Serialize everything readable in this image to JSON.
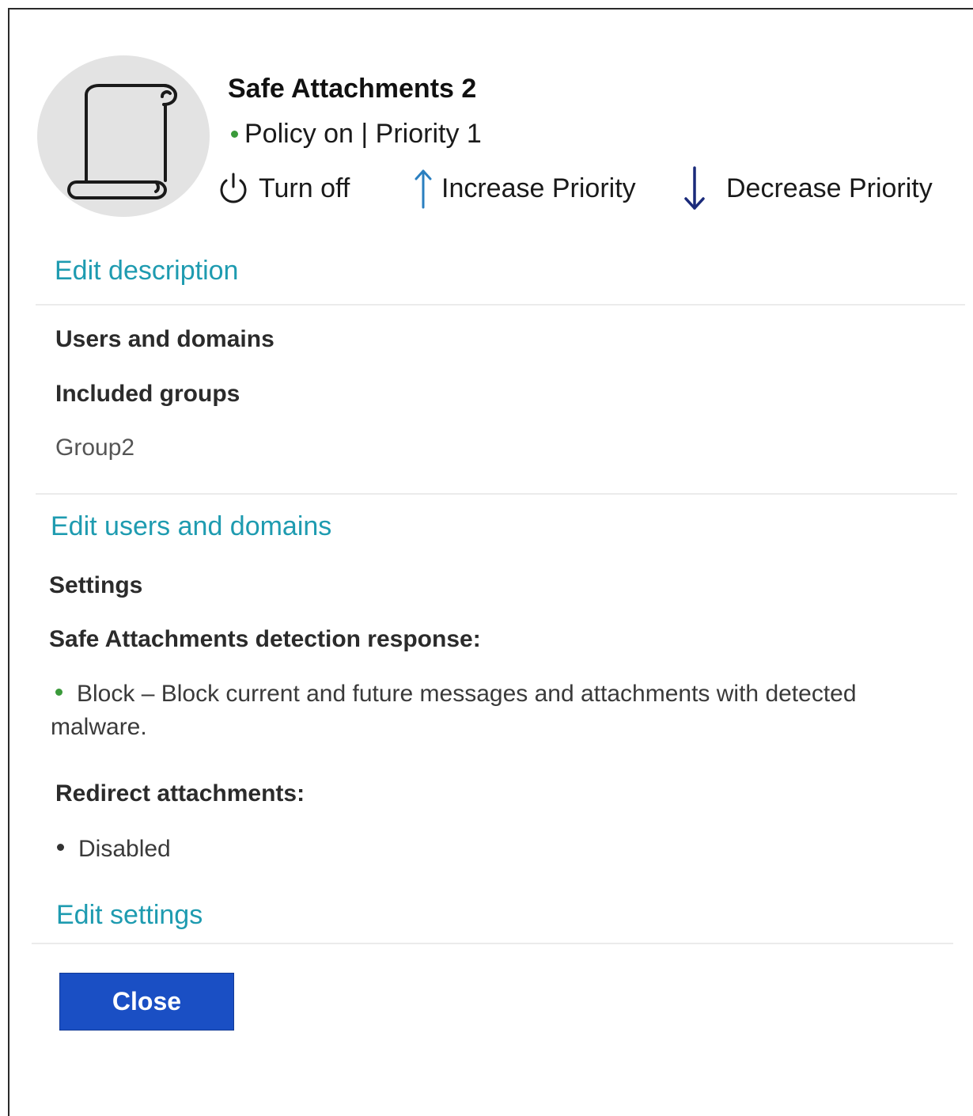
{
  "policy": {
    "name": "Safe Attachments 2",
    "status": "Policy on | Priority 1",
    "status_color": "#3a9a3a"
  },
  "actions": {
    "turn_off": "Turn off",
    "increase_priority": "Increase Priority",
    "decrease_priority": "Decrease Priority"
  },
  "icons": {
    "avatar": "scroll-icon",
    "turn_off": "power-icon",
    "increase_priority": "arrow-up-icon",
    "decrease_priority": "arrow-down-icon"
  },
  "links": {
    "edit_description": "Edit description",
    "edit_users_domains": "Edit users and domains",
    "edit_settings": "Edit settings"
  },
  "users_domains": {
    "heading": "Users and domains",
    "included_groups_label": "Included groups",
    "included_groups_value": "Group2"
  },
  "settings": {
    "heading": "Settings",
    "detection_response_label": "Safe Attachments detection response:",
    "detection_response_value": "Block – Block current and future messages and attachments with detected malware.",
    "redirect_label": "Redirect attachments:",
    "redirect_value": "Disabled"
  },
  "colors": {
    "link": "#1e9bb0",
    "primary_button": "#1a4fc4",
    "green_bullet": "#3a9a3a"
  },
  "buttons": {
    "close": "Close"
  }
}
